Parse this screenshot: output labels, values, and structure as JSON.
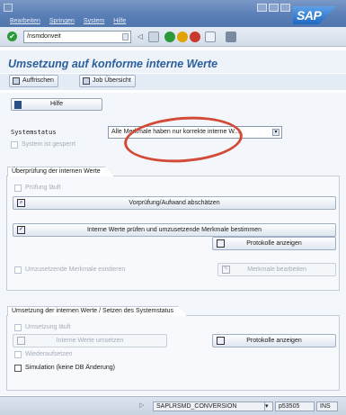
{
  "menu": {
    "items": [
      "Bearbeiten",
      "Springen",
      "System",
      "Hilfe"
    ]
  },
  "command_field": {
    "value": "/nsmdonveit"
  },
  "title": "Umsetzung auf konforme interne Werte",
  "app_toolbar": {
    "refresh_label": "Auffrischen",
    "job_overview_label": "Job Übersicht"
  },
  "help_button": {
    "label": "Hilfe"
  },
  "system_status": {
    "label": "Systemstatus",
    "value": "Alle Merkmale haben nur korrekte interne W...",
    "locked_label": "System ist gesperrt"
  },
  "group_check": {
    "title": "Überprüfung der internen Werte",
    "check_running_label": "Prüfung läuft",
    "precheck_button": "Vorprüfung/Aufwand abschätzen",
    "determine_button": "Interne Werte prüfen und umzusetzende Merkmale bestimmen",
    "logs_button": "Protokolle anzeigen",
    "chars_exist_label": "Umzusetzende Merkmale existieren",
    "edit_chars_button": "Merkmale bearbeiten"
  },
  "group_convert": {
    "title": "Umsetzung der internen Werte / Setzen des Systemstatus",
    "conversion_running_label": "Umsetzung läuft",
    "convert_button": "Interne Werte umsetzen",
    "logs_button": "Protokolle anzeigen",
    "rerun_label": "Wiederaufsetzen",
    "simulation_label": "Simulation (keine DB Änderung)"
  },
  "status_bar": {
    "program": "SAPLRSMD_CONVERSION",
    "server": "p53505",
    "mode": "INS"
  },
  "colors": {
    "header_blue": "#5a7fb6",
    "title_blue": "#2c5f9c",
    "annotation_red": "#d24b38"
  }
}
